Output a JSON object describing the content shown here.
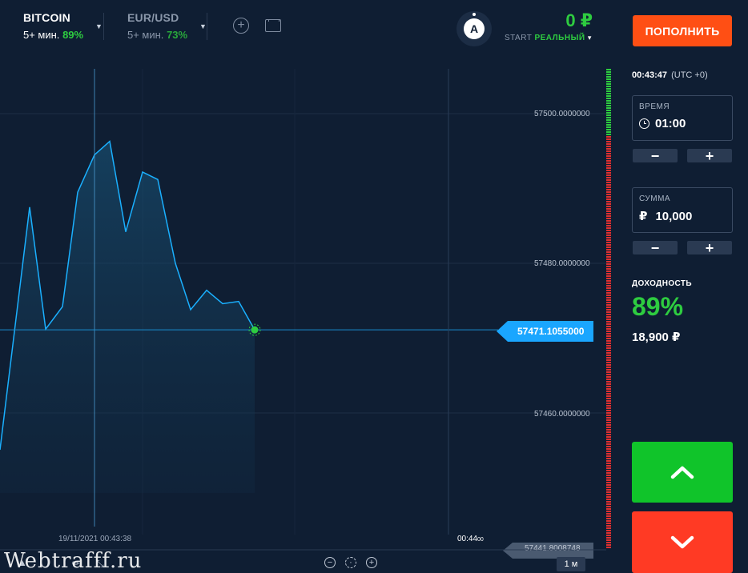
{
  "assets": [
    {
      "name": "BITCOIN",
      "duration": "5+ мин.",
      "payout": "89%",
      "active": true
    },
    {
      "name": "EUR/USD",
      "duration": "5+ мин.",
      "payout": "73%",
      "active": false
    }
  ],
  "header": {
    "avatar_letter": "A",
    "balance": "0 ₽",
    "account_start": "START",
    "account_type": "РЕАЛЬНЫЙ",
    "account_caret": "▾",
    "deposit_label": "ПОПОЛНИТЬ"
  },
  "chart": {
    "y_labels": [
      "57500.0000000",
      "57480.0000000",
      "57460.0000000"
    ],
    "current_price": "57471.1055000",
    "cut_price": "57441.8008748",
    "crosshair_time": "19/11/2021 00:43:38",
    "expiry_time": "00:44",
    "expiry_seconds": "00",
    "timeframe": "1 м",
    "colors": {
      "line": "#1ab0ff",
      "price_tag": "#1aa6ff",
      "dot": "#2ecc40"
    }
  },
  "chart_data": {
    "type": "area",
    "ylim": [
      57441.8,
      57506
    ],
    "y_ticks": [
      57500,
      57480,
      57460
    ],
    "values": [
      57445.0,
      57487.5,
      57471.2,
      57474.2,
      57489.5,
      57494.5,
      57496.3,
      57484.2,
      57492.2,
      57491.2,
      57480.0,
      57473.8,
      57476.4,
      57474.6,
      57474.9,
      57471.1
    ],
    "current": 57471.1055,
    "grid": true
  },
  "panel": {
    "clock": "00:43:47",
    "timezone": "(UTC +0)",
    "time_label": "ВРЕМЯ",
    "time_value": "01:00",
    "amount_label": "СУММА",
    "currency_sign": "₽",
    "amount_value": "10,000",
    "minus": "−",
    "plus": "+",
    "profit_label": "ДОХОДНОСТЬ",
    "profit_pct": "89%",
    "profit_amount": "18,900 ₽"
  },
  "watermark": "Webtrafff.ru",
  "sentiment": {
    "up_fraction": 0.14,
    "up_color": "#2ecc40",
    "down_color": "#e03030"
  }
}
